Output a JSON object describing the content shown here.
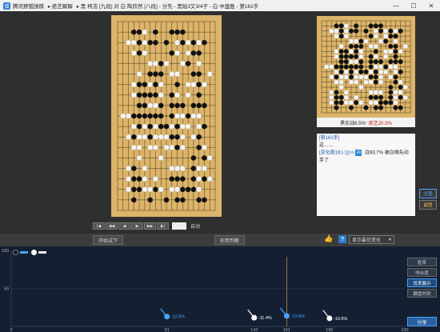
{
  "window": {
    "app_name": "腾讯野狐围棋",
    "segments": [
      "▸ 绝艺解解",
      "▸ 黑 柯洁 [九段] 对 白 陶欣然 [八段] - 分先 - 黑贴3又3/4子 - 白 中盘胜 - 第161手"
    ],
    "btn_min": "—",
    "btn_max": "☐",
    "btn_close": "✕"
  },
  "analysis": {
    "black_wr": "黑实战6.5%",
    "sep": " - ",
    "ai_wr": "绝艺20.3%"
  },
  "comment": {
    "move_tag": "[第161手]",
    "line1": "这……",
    "variation_link": "[变化图161-1]>>",
    "ai_text": "白93.7% 被白棋先动手了",
    "ai_avatar": "AI"
  },
  "side_tabs": [
    "主图",
    "副图"
  ],
  "nav": {
    "buttons": [
      "|◀",
      "◀◀",
      "◀",
      "▶",
      "▶▶",
      "▶|"
    ],
    "move_input": "",
    "auto_label": "自动"
  },
  "toolbar": {
    "try_label": "开始试下",
    "judge_label": "形势判断",
    "like_icon": "👍",
    "help_icon": "?",
    "select_value": "显示最优变化",
    "select_arrow": "▼"
  },
  "graph_buttons": [
    "胜率",
    "吻合度",
    "优率展示",
    "翻盘时刻"
  ],
  "share_label": "分享",
  "chart_data": {
    "type": "line",
    "title": "",
    "xlabel": "",
    "ylabel": "",
    "x_ticks": [
      0,
      91,
      142,
      186,
      161,
      230
    ],
    "x_tick_labels": [
      "0",
      "91",
      "142",
      "186",
      "161",
      "230"
    ],
    "y_ticks": [
      50,
      100
    ],
    "y_tick_labels": [
      "50",
      "100"
    ],
    "xlim": [
      0,
      230
    ],
    "ylim": [
      0,
      100
    ],
    "markers": [
      {
        "x": 91,
        "y": 12.9,
        "label": "-12.9%",
        "color": "#4aa3ff"
      },
      {
        "x": 142,
        "y": 11.4,
        "label": "-11.4%",
        "color": "#ffffff"
      },
      {
        "x": 186,
        "y": 10.6,
        "label": "-10.6%",
        "color": "#ffffff"
      },
      {
        "x": 161,
        "y": 13.8,
        "label": "-13.8%",
        "color": "#4aa3ff"
      }
    ],
    "current_move": 161
  }
}
